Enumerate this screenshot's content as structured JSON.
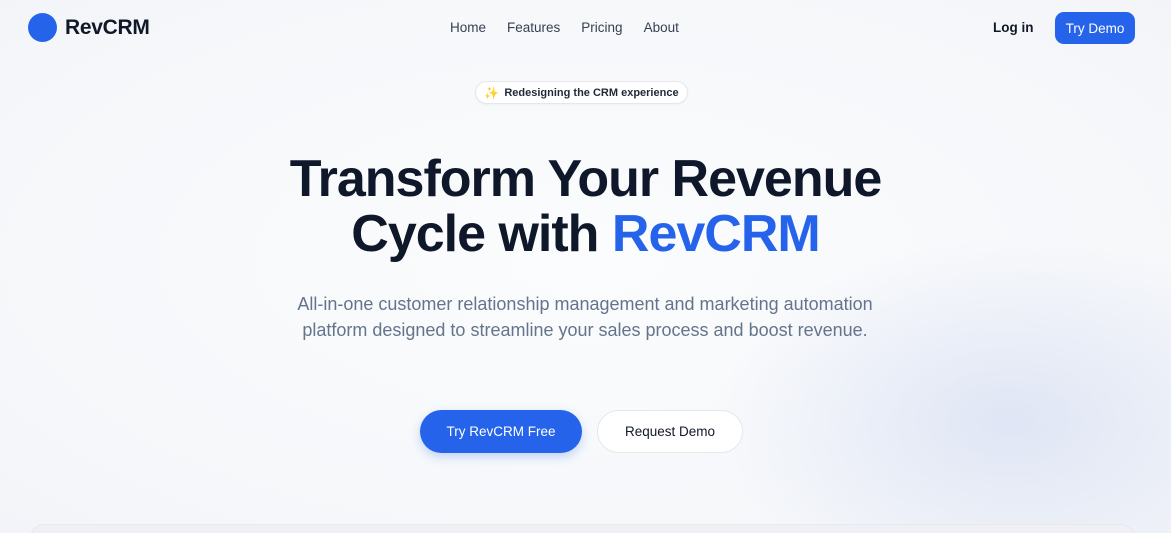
{
  "brand": {
    "name": "RevCRM",
    "color": "#2563eb"
  },
  "nav": {
    "links": [
      "Home",
      "Features",
      "Pricing",
      "About"
    ],
    "login": "Log in",
    "try_demo": "Try Demo"
  },
  "badge": {
    "icon": "sparkle-icon",
    "text": "Redesigning the CRM experience"
  },
  "hero": {
    "title_line1": "Transform Your Revenue",
    "title_line2_plain": "Cycle with ",
    "title_line2_accent": "RevCRM",
    "subtitle": "All-in-one customer relationship management and marketing automation platform designed to streamline your sales process and boost revenue.",
    "cta_primary": "Try RevCRM Free",
    "cta_secondary": "Request Demo"
  },
  "colors": {
    "accent": "#2563eb",
    "text": "#0f172a",
    "muted": "#64748b"
  }
}
